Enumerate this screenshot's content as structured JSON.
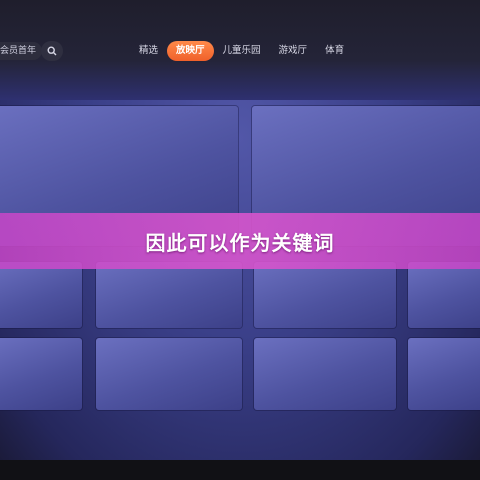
{
  "header": {
    "member_label": "会员首年",
    "search_icon": "search-icon",
    "tabs": [
      {
        "label": "精选",
        "active": false
      },
      {
        "label": "放映厅",
        "active": true
      },
      {
        "label": "儿童乐园",
        "active": false
      },
      {
        "label": "游戏厅",
        "active": false
      },
      {
        "label": "体育",
        "active": false
      }
    ]
  },
  "overlay": {
    "caption": "因此可以作为关键词"
  },
  "colors": {
    "accent_tab": "#f0602a",
    "banner": "#d255cd",
    "background": "#3a3f88"
  }
}
